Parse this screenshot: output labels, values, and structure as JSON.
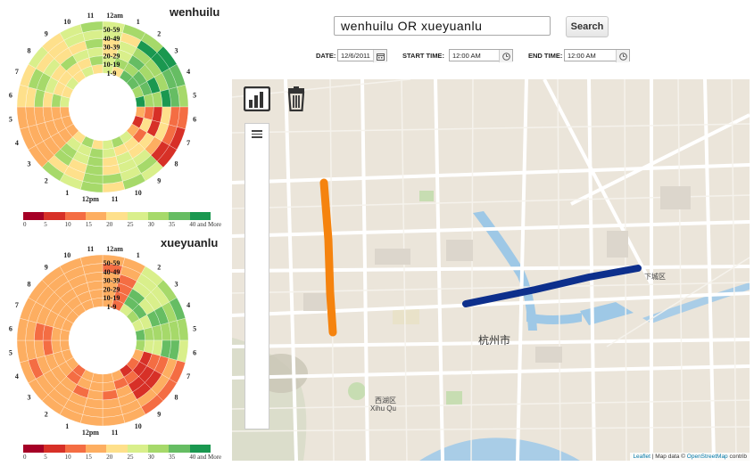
{
  "left_panel": {
    "chart1_title": "wenhuilu",
    "chart2_title": "xueyuanlu",
    "ring_labels": [
      "50-59",
      "40-49",
      "30-39",
      "20-29",
      "10-19",
      "1-9"
    ],
    "hour_labels": [
      "12am",
      "1",
      "2",
      "3",
      "4",
      "5",
      "6",
      "7",
      "8",
      "9",
      "10",
      "11",
      "12pm",
      "1",
      "2",
      "3",
      "4",
      "5",
      "6",
      "7",
      "8",
      "9",
      "10",
      "11"
    ],
    "legend": {
      "colors": [
        "#a50026",
        "#d73027",
        "#f46d43",
        "#fdae61",
        "#fee08b",
        "#d9ef8b",
        "#a6d96a",
        "#66bd63",
        "#1a9850"
      ],
      "labels": [
        "0",
        "5",
        "10",
        "15",
        "20",
        "25",
        "30",
        "35",
        "40 and More"
      ]
    }
  },
  "header": {
    "search_value": "wenhuilu  OR  xueyuanlu",
    "search_button": "Search",
    "date_label": "DATE:",
    "date_value": "12/6/2011",
    "start_label": "START TIME:",
    "start_value": "12:00 AM",
    "end_label": "END TIME:",
    "end_value": "12:00 AM"
  },
  "map": {
    "city_label": "杭州市",
    "district_label": "下城区",
    "xihu_cn": "西湖区",
    "xihu_en": "Xihu Qu",
    "road_colors": {
      "wenhuilu": "#0d2f8c",
      "xueyuanlu": "#f5830e"
    },
    "attribution_leaflet": "Leaflet",
    "attribution_text": " | Map data © ",
    "attribution_osm": "OpenStreetMap",
    "attribution_tail": " contrib"
  },
  "icons": {
    "chart": "bar-chart-icon",
    "trash": "trash-icon",
    "menu": "hamburger-menu-icon",
    "calendar": "calendar-icon",
    "clock": "clock-icon"
  }
}
